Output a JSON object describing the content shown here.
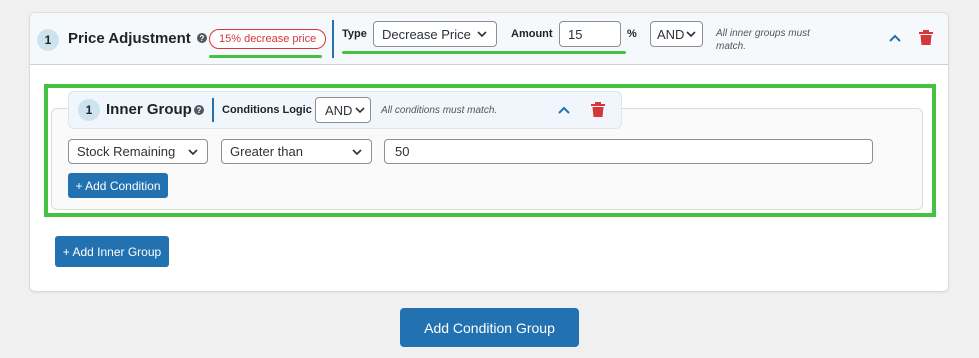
{
  "price_group": {
    "number": "1",
    "title": "Price Adjustment",
    "help": "?",
    "badge": "15% decrease price",
    "type_label": "Type",
    "type_value": "Decrease Price",
    "amount_label": "Amount",
    "amount_value": "15",
    "amount_unit": "%",
    "logic_value": "AND",
    "logic_note": "All inner groups must match."
  },
  "inner_group": {
    "number": "1",
    "title": "Inner Group",
    "help": "?",
    "logic_label": "Conditions Logic",
    "logic_value": "AND",
    "logic_note": "All conditions must match.",
    "condition": {
      "field": "Stock Remaining",
      "operator": "Greater than",
      "value": "50"
    },
    "add_condition_label": "+ Add Condition"
  },
  "add_inner_group_label": "+ Add Inner Group",
  "add_condition_group_label": "Add Condition Group",
  "icons": [
    "help-icon",
    "chevron-down-icon",
    "chevron-up-icon",
    "trash-icon"
  ],
  "colors": {
    "accent": "#2271b1",
    "danger": "#d63638",
    "highlight": "#46c243",
    "badge_bg": "#cde4ef"
  }
}
